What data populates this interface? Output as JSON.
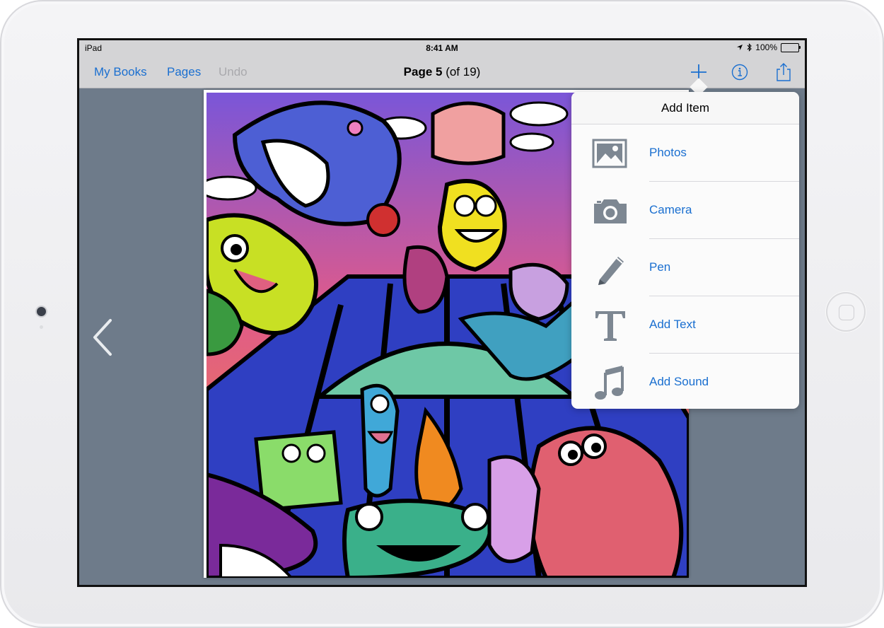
{
  "status": {
    "carrier": "iPad",
    "time": "8:41 AM",
    "battery": "100%",
    "battery_level": 1.0
  },
  "nav": {
    "my_books": "My Books",
    "pages": "Pages",
    "undo": "Undo",
    "title_bold": "Page 5",
    "title_rest": " (of 19)"
  },
  "icons": {
    "add": "plus-icon",
    "info": "info-icon",
    "share": "share-icon",
    "prev": "chevron-left-icon"
  },
  "popover": {
    "title": "Add Item",
    "items": [
      {
        "label": "Photos",
        "icon": "photo-icon"
      },
      {
        "label": "Camera",
        "icon": "camera-icon"
      },
      {
        "label": "Pen",
        "icon": "pen-icon"
      },
      {
        "label": "Add Text",
        "icon": "text-icon"
      },
      {
        "label": "Add Sound",
        "icon": "music-note-icon"
      }
    ]
  },
  "colors": {
    "accent": "#1a6fd0",
    "icon_gray": "#7d8792",
    "background": "#6e7b8a"
  }
}
